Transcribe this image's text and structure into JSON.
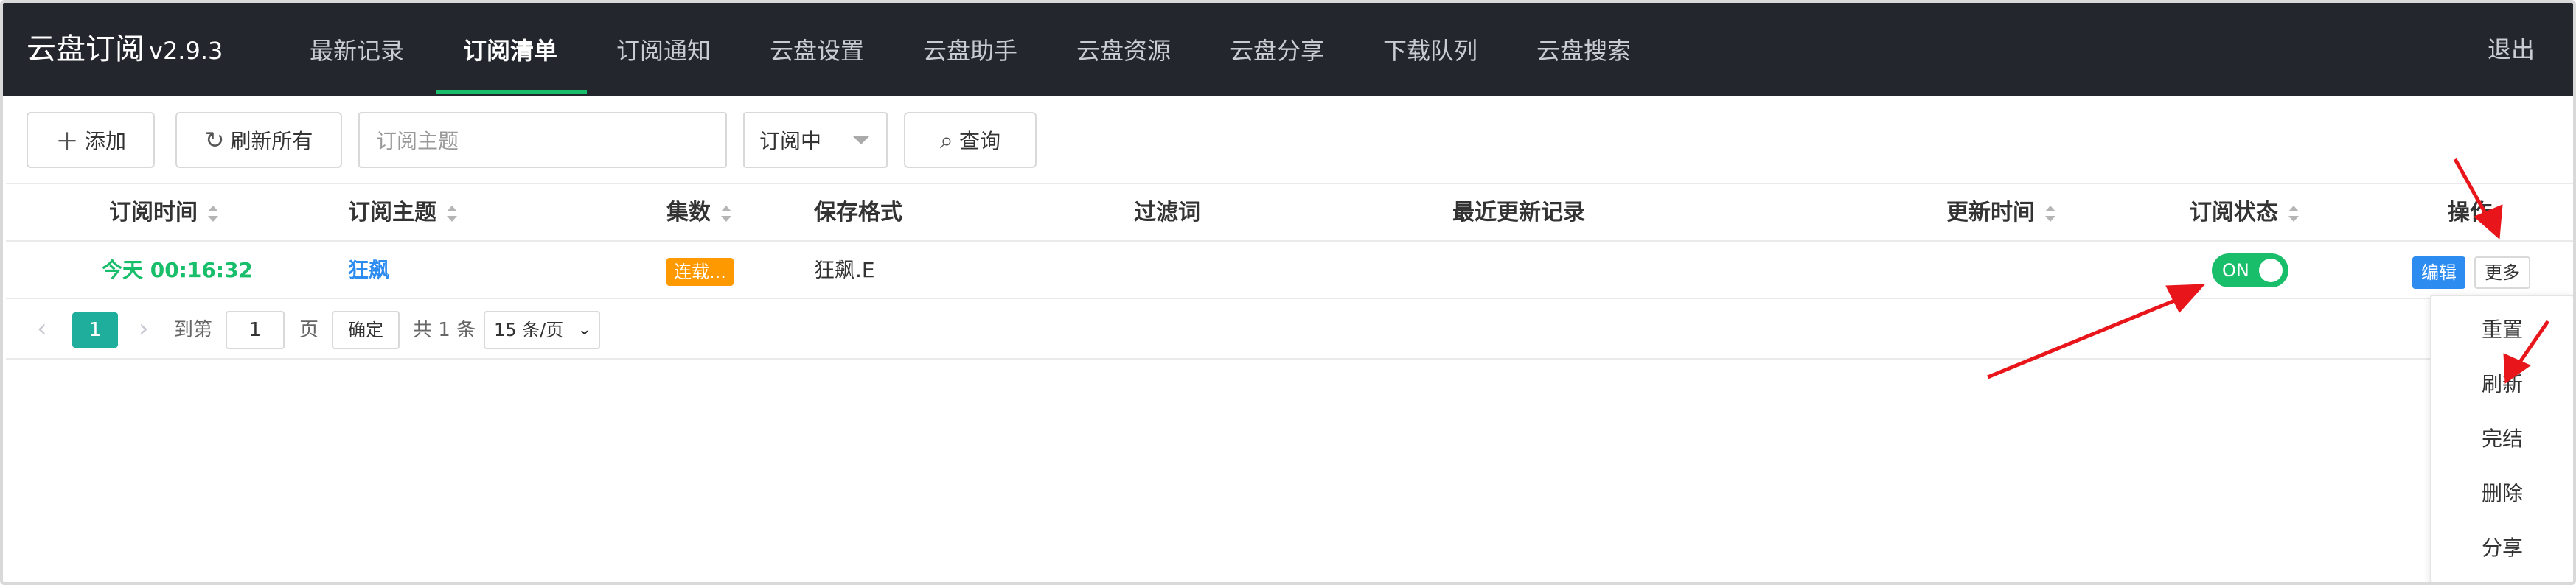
{
  "header": {
    "app_name": "云盘订阅",
    "version": "v2.9.3",
    "nav": [
      "最新记录",
      "订阅清单",
      "订阅通知",
      "云盘设置",
      "云盘助手",
      "云盘资源",
      "云盘分享",
      "下载队列",
      "云盘搜索"
    ],
    "active_nav": "订阅清单",
    "logout": "退出",
    "accent_color": "#19be6b"
  },
  "toolbar": {
    "add_label": "添加",
    "refresh_all_label": "刷新所有",
    "topic_placeholder": "订阅主题",
    "status_filter": "订阅中",
    "query_label": "查询"
  },
  "table": {
    "columns": [
      "订阅时间",
      "订阅主题",
      "集数",
      "保存格式",
      "过滤词",
      "最近更新记录",
      "更新时间",
      "订阅状态",
      "操作"
    ],
    "rows": [
      {
        "time": "今天 00:16:32",
        "topic": "狂飙",
        "episodes": "连载...",
        "save_format": "狂飙.E",
        "filter": "",
        "recent": "",
        "updated": "",
        "status": "ON",
        "edit": "编辑",
        "more": "更多"
      }
    ]
  },
  "pagination": {
    "current_page": "1",
    "goto_label": "到第",
    "goto_value": "1",
    "page_unit": "页",
    "confirm": "确定",
    "total": "共 1 条",
    "page_size": "15 条/页"
  },
  "more_menu": [
    "重置",
    "刷新",
    "完结",
    "删除",
    "分享"
  ],
  "colors": {
    "topbar": "#23272d",
    "success": "#19be6b",
    "link": "#2d8cf0",
    "warning": "#ff9900",
    "pager": "#1fad9c",
    "annotation": "#e8161b"
  }
}
